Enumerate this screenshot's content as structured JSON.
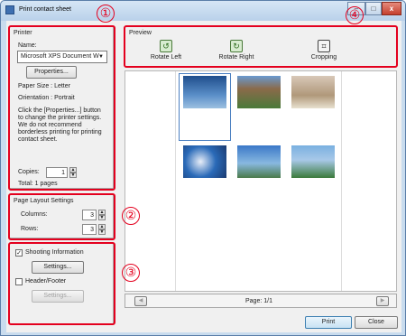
{
  "window": {
    "title": "Print contact sheet",
    "minimize": "–",
    "maximize": "□",
    "close": "x"
  },
  "printer": {
    "legend": "Printer",
    "name_label": "Name:",
    "name_value": "Microsoft XPS Document W",
    "properties_button": "Properties...",
    "paper_size": "Paper Size : Letter",
    "orientation": "Orientation : Portrait",
    "help_lines": [
      "Click the [Properties...] button",
      "to change the printer settings.",
      "We do not recommend",
      "borderless printing for printing",
      "contact sheet."
    ],
    "copies_label": "Copies:",
    "copies_value": "1",
    "total": "Total: 1 pages"
  },
  "layout": {
    "legend": "Page Layout Settings",
    "columns_label": "Columns:",
    "columns_value": "3",
    "rows_label": "Rows:",
    "rows_value": "3"
  },
  "options": {
    "shooting_label": "Shooting Information",
    "shooting_checked": true,
    "shooting_settings": "Settings...",
    "header_label": "Header/Footer",
    "header_checked": false,
    "header_settings": "Settings..."
  },
  "preview": {
    "legend": "Preview",
    "rotate_left": "Rotate Left",
    "rotate_right": "Rotate Right",
    "cropping": "Cropping",
    "page_label": "Page: 1/1",
    "prev": "◀",
    "next": "▶"
  },
  "footer": {
    "print": "Print",
    "close": "Close"
  },
  "callouts": [
    "①",
    "②",
    "③",
    "④"
  ],
  "colors": {
    "callout_red": "#e4001e",
    "selection_blue": "#4a7fc1"
  }
}
